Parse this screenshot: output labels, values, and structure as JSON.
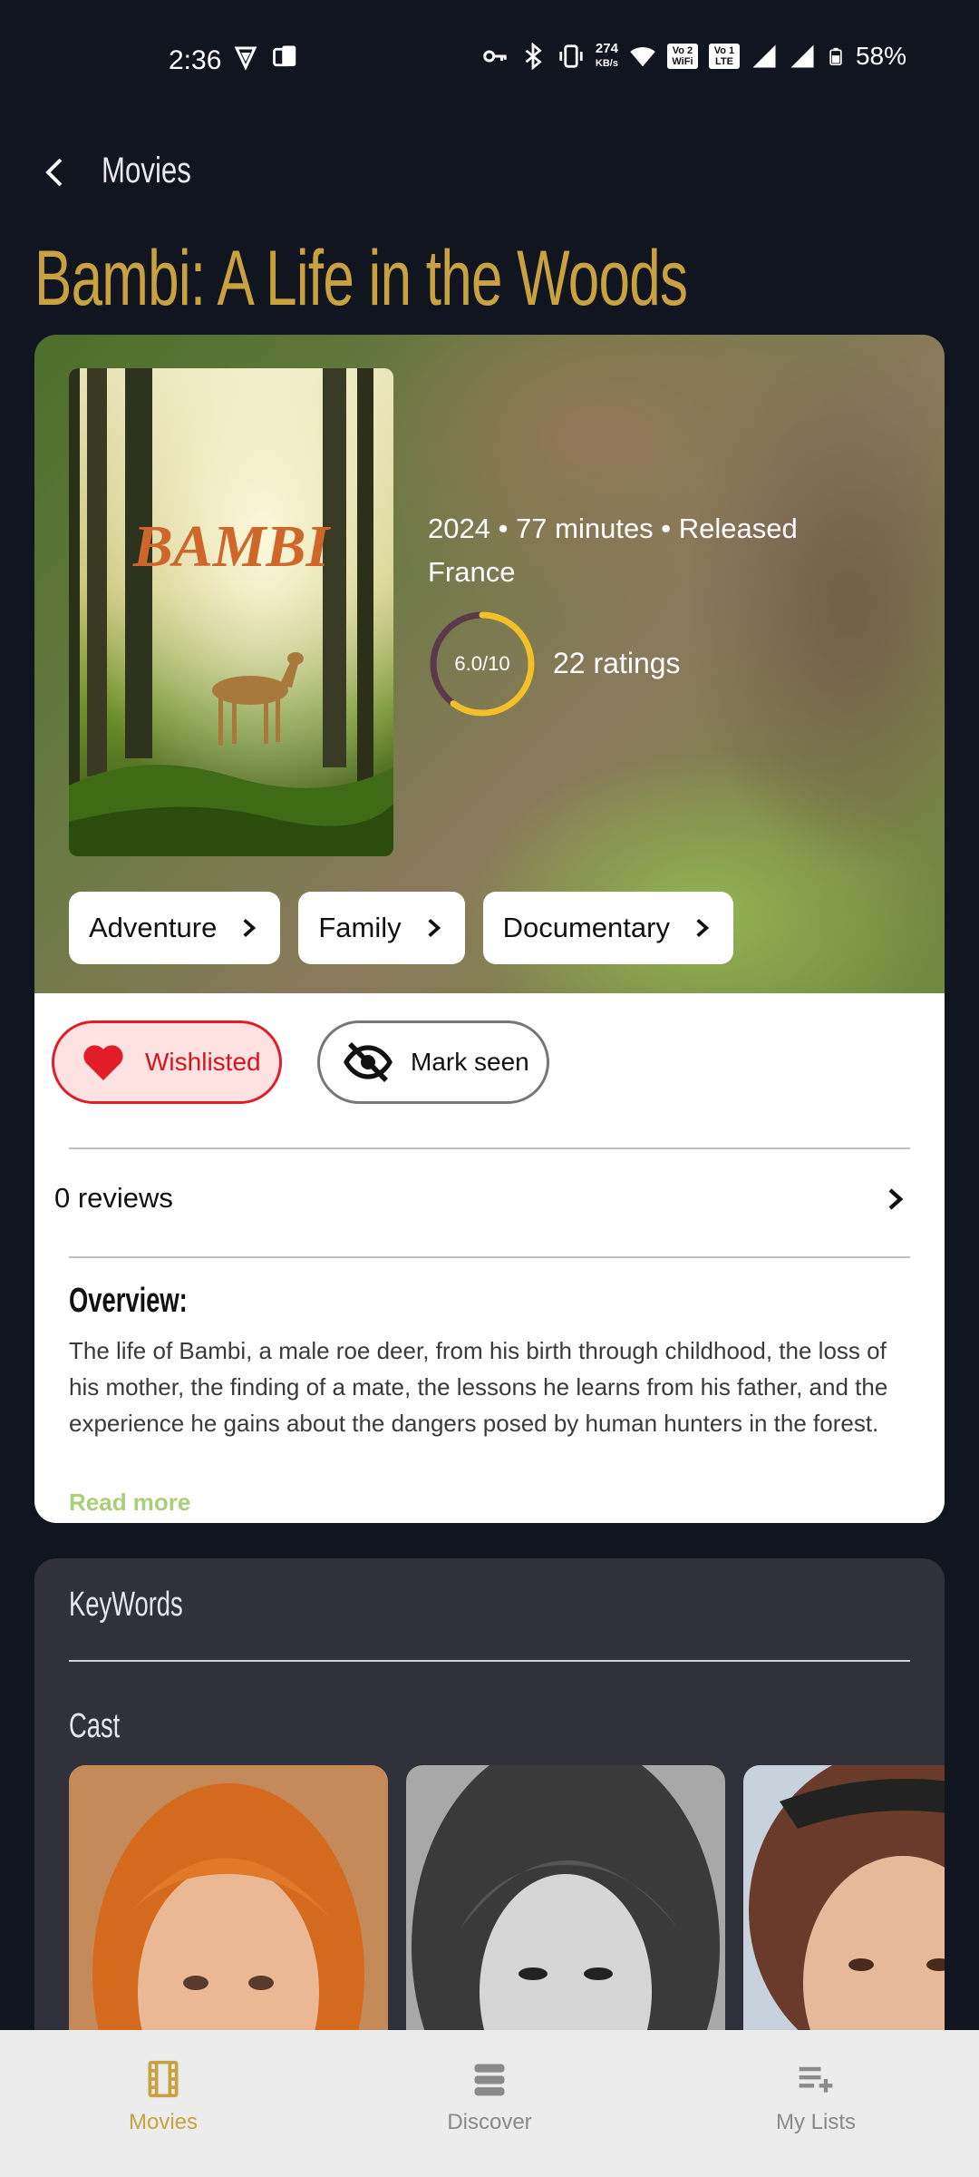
{
  "status_bar": {
    "time": "2:36",
    "net_speed": "274",
    "net_unit": "KB/s",
    "sim1": "Vo 2 WiFi",
    "sim2": "Vo 1 LTE",
    "battery": "58%"
  },
  "app_bar": {
    "title": "Movies"
  },
  "movie": {
    "title": "Bambi: A Life in the Woods",
    "poster_title": "BAMBI",
    "meta_line1": "2024 • 77 minutes • Released",
    "meta_line2": "France",
    "rating": "6.0/10",
    "rating_fraction": 0.6,
    "ratings_count": "22 ratings",
    "genres": [
      "Adventure",
      "Family",
      "Documentary"
    ]
  },
  "actions": {
    "wishlist_label": "Wishlisted",
    "seen_label": "Mark seen"
  },
  "reviews": {
    "label": "0 reviews"
  },
  "overview": {
    "heading": "Overview:",
    "text": "The life of Bambi, a male roe deer, from his birth through childhood, the loss of his mother, the finding of a mate, the lessons he learns from his father, and the experience he gains about the dangers posed by human hunters in the forest.",
    "read_more": "Read more"
  },
  "sections": {
    "keywords_heading": "KeyWords",
    "cast_heading": "Cast"
  },
  "bottom_nav": {
    "items": [
      {
        "label": "Movies",
        "icon": "film-icon",
        "active": true
      },
      {
        "label": "Discover",
        "icon": "stack-icon",
        "active": false
      },
      {
        "label": "My Lists",
        "icon": "playlist-add-icon",
        "active": false
      }
    ]
  },
  "colors": {
    "accent_gold": "#c9a240",
    "wishlist_red": "#e11d2a",
    "background": "#111520",
    "dark_card": "#31313c"
  }
}
